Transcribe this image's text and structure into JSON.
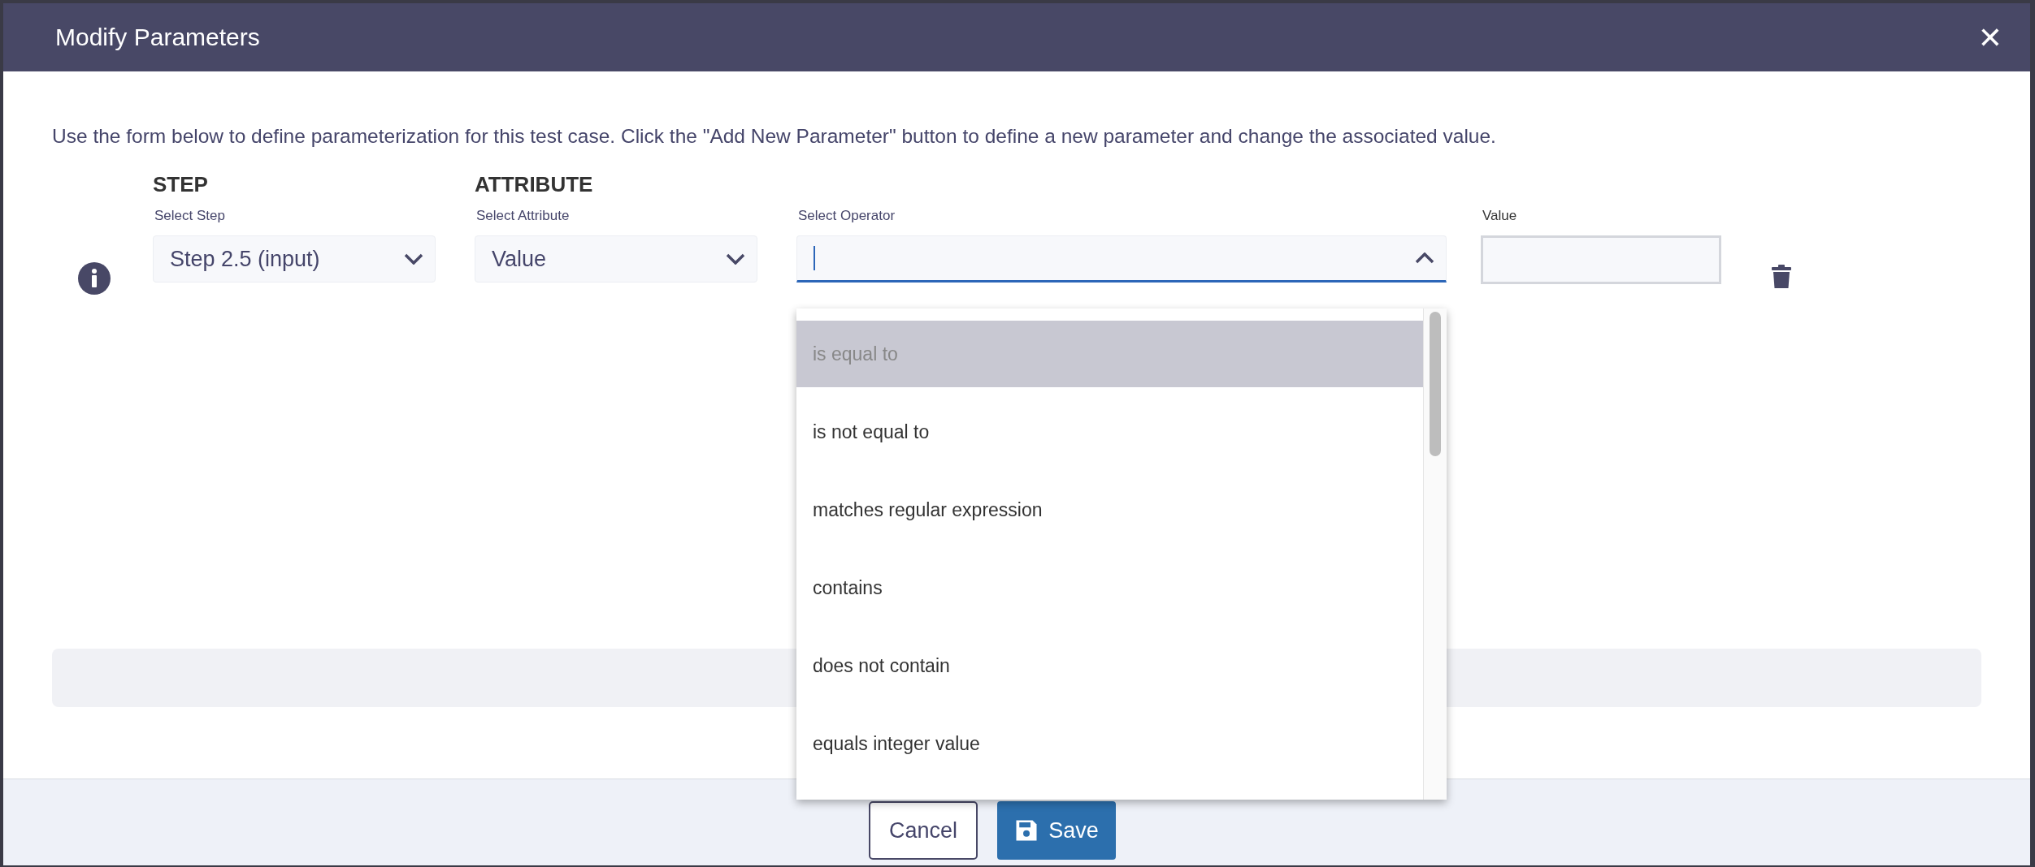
{
  "dialog": {
    "title": "Modify Parameters",
    "close": "✕"
  },
  "description": "Use the form below to define parameterization for this test case. Click the \"Add New Parameter\" button to define a new parameter and change the associated value.",
  "parameter": {
    "step": {
      "heading": "STEP",
      "label": "Select Step",
      "value": "Step 2.5 (input)"
    },
    "attribute": {
      "heading": "ATTRIBUTE",
      "label": "Select Attribute",
      "value": "Value"
    },
    "operator": {
      "label": "Select Operator",
      "expanded": true,
      "options": [
        {
          "label": "is equal to",
          "selected": true
        },
        {
          "label": "is not equal to",
          "selected": false
        },
        {
          "label": "matches regular expression",
          "selected": false
        },
        {
          "label": "contains",
          "selected": false
        },
        {
          "label": "does not contain",
          "selected": false
        },
        {
          "label": "equals integer value",
          "selected": false
        }
      ]
    },
    "value": {
      "label": "Value"
    }
  },
  "buttons": {
    "cancel": "Cancel",
    "save": "Save"
  }
}
